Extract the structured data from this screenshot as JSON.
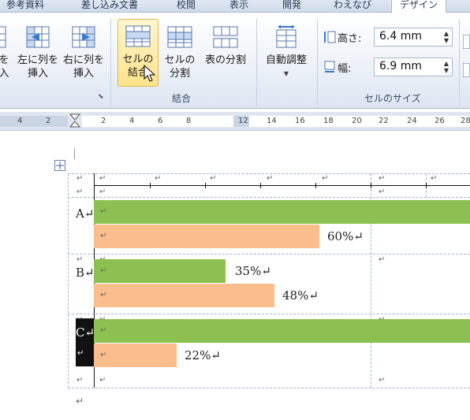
{
  "tabs": [
    "参考資料",
    "差し込み文書",
    "校閲",
    "表示",
    "開発",
    "わえなび",
    "デザイン"
  ],
  "ribbon": {
    "insert_below_label": [
      "を",
      "入"
    ],
    "insert_left_label": [
      "左に列を",
      "挿入"
    ],
    "insert_right_label": [
      "右に列を",
      "挿入"
    ],
    "merge_cells_label": [
      "セルの",
      "結合"
    ],
    "split_cells_label": [
      "セルの",
      "分割"
    ],
    "split_table_label": "表の分割",
    "autofit_label": "自動調整",
    "group_merge": "結合",
    "group_cellsize": "セルのサイズ",
    "height_label": "高さ:",
    "height_value": "6.4 mm",
    "width_label": "幅:",
    "width_value": "6.9 mm"
  },
  "ruler": [
    "4",
    "2",
    "2",
    "4",
    "6",
    "8",
    "12",
    "14",
    "16",
    "18",
    "20",
    "22",
    "24",
    "26",
    "28"
  ],
  "table": {
    "rows": [
      {
        "label": "A",
        "green_pct": 100,
        "orange_pct": 60,
        "orange_label": "60%"
      },
      {
        "label": "B",
        "green_pct": 35,
        "green_label": "35%",
        "orange_pct": 48,
        "orange_label": "48%"
      },
      {
        "label": "C",
        "green_pct": 100,
        "orange_pct": 22,
        "orange_label": "22%"
      }
    ]
  },
  "marks": {
    "return": "↵"
  },
  "colors": {
    "green": "#8cc050",
    "orange": "#fbbd8b",
    "accent": "#ffe38a"
  }
}
